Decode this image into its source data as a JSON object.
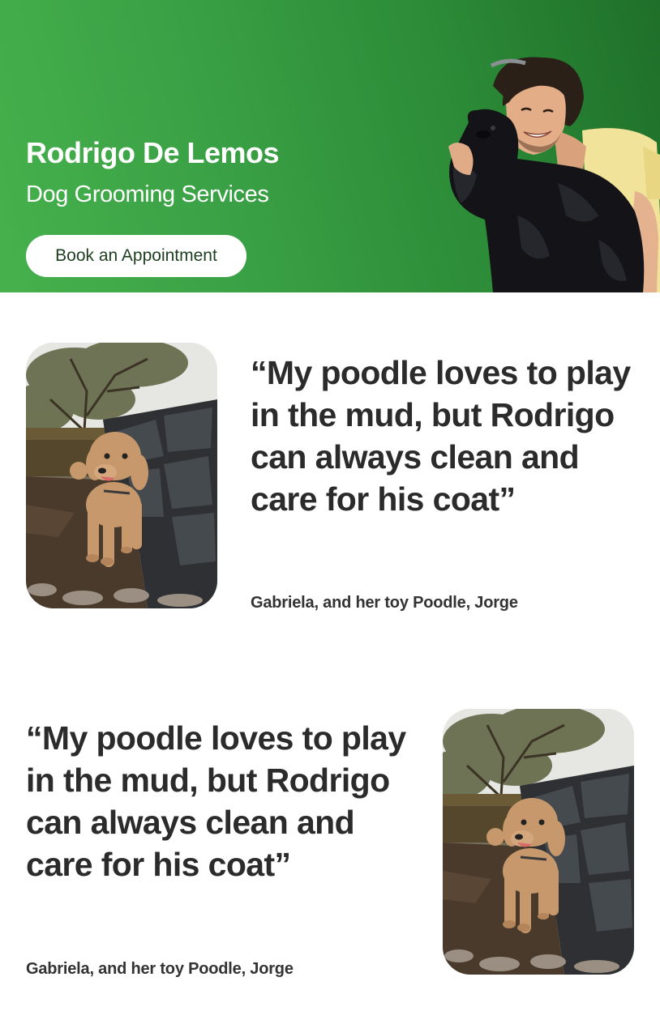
{
  "hero": {
    "name": "Rodrigo De Lemos",
    "subtitle": "Dog Grooming Services",
    "cta_label": "Book an Appointment",
    "gradient_colors": [
      "#46b14c",
      "#1f6f2a"
    ]
  },
  "testimonials": [
    {
      "quote": "“My poodle loves to play in the mud, but Rodrigo can always clean and care for his coat”",
      "author": "Gabriela, and her toy Poodle, Jorge",
      "photo_side": "left"
    },
    {
      "quote": "“My poodle loves to play in the mud, but Rodrigo can always clean and care for his coat”",
      "author": "Gabriela, and her toy Poodle, Jorge",
      "photo_side": "right"
    }
  ],
  "colors": {
    "text": "#2b2b2b",
    "button_text": "#1e3e20",
    "button_bg": "#ffffff"
  }
}
